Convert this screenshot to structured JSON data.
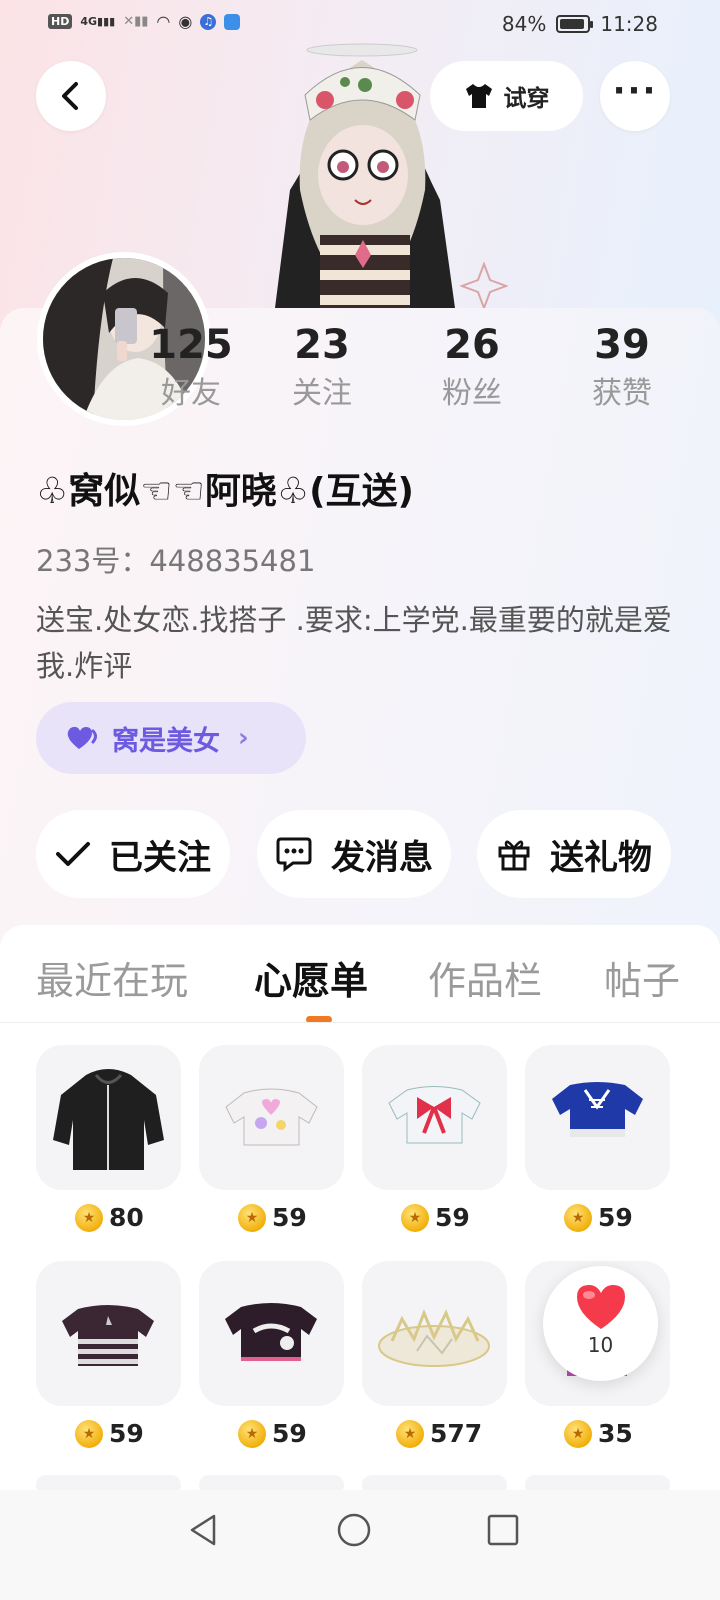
{
  "status_bar": {
    "hd": "HD",
    "signal_4g": "4G",
    "battery": "84%",
    "time": "11:28"
  },
  "header": {
    "try_on_label": "试穿"
  },
  "profile": {
    "stats": [
      {
        "value": "125",
        "label": "好友"
      },
      {
        "value": "23",
        "label": "关注"
      },
      {
        "value": "26",
        "label": "粉丝"
      },
      {
        "value": "39",
        "label": "获赞"
      }
    ],
    "nickname": "♧窝似☜☜阿晓♧(互送)",
    "uid": "233号：448835481",
    "bio": "送宝.处女恋.找搭子 .要求:上学党.最重要的就是爱我.炸评",
    "group_label": "窝是美女"
  },
  "actions": {
    "follow": "已关注",
    "message": "发消息",
    "gift": "送礼物"
  },
  "tabs": [
    {
      "label": "最近在玩"
    },
    {
      "label": "心愿单"
    },
    {
      "label": "作品栏"
    },
    {
      "label": "帖子"
    }
  ],
  "wishlist": [
    {
      "icon": "black-hoodie",
      "price": "80"
    },
    {
      "icon": "heart-crop-top",
      "price": "59"
    },
    {
      "icon": "bow-crop-top",
      "price": "59"
    },
    {
      "icon": "blue-lace-top",
      "price": "59"
    },
    {
      "icon": "striped-crop-top",
      "price": "59"
    },
    {
      "icon": "black-print-top",
      "price": "59"
    },
    {
      "icon": "crystal-crown",
      "price": "577"
    },
    {
      "icon": "pink-top",
      "price": "35"
    }
  ],
  "like_bubble": {
    "count": "10"
  },
  "colors": {
    "accent": "#f07a24",
    "group_pill_bg": "#e9e3fa",
    "group_pill_text": "#6c5ae0",
    "coin": "#f2b00c"
  }
}
